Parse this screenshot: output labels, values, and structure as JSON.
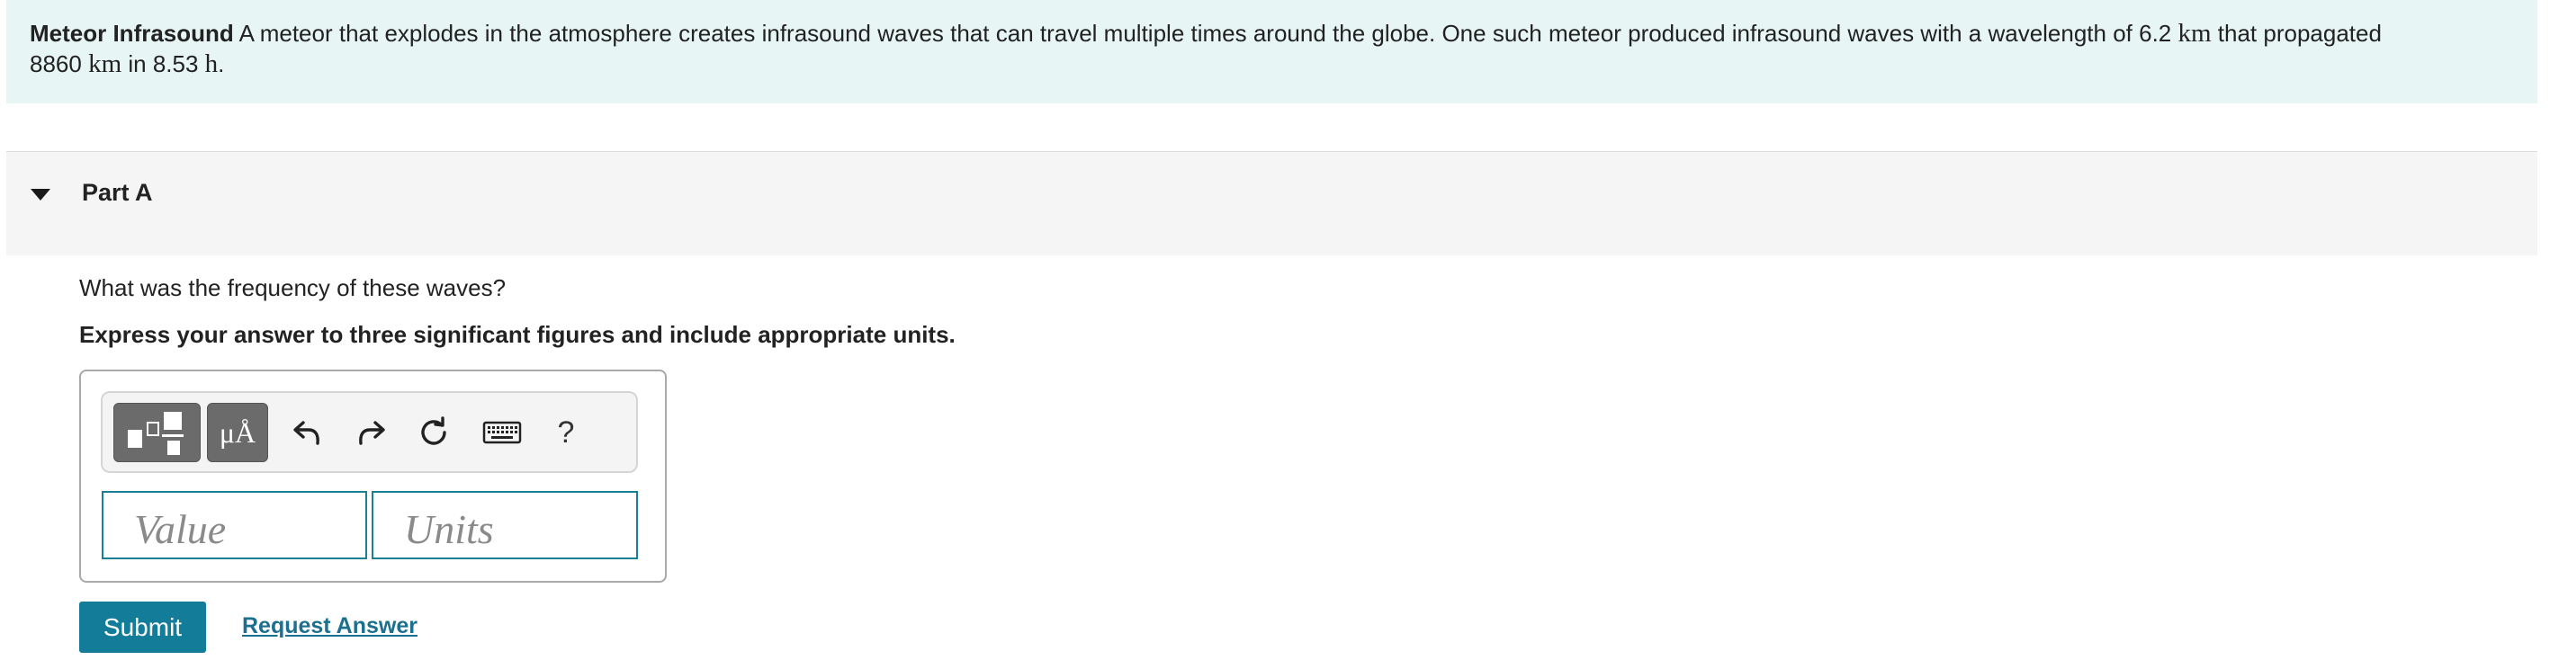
{
  "problem": {
    "title": "Meteor Infrasound",
    "text_1": " A meteor that explodes in the atmosphere creates infrasound waves that can travel multiple times around the globe. One such meteor produced infrasound waves with a wavelength of 6.2 ",
    "unit_km_1": "km",
    "text_2": " that propagated",
    "text_3": "8860 ",
    "unit_km_2": "km",
    "text_4": " in 8.53 ",
    "unit_h": "h",
    "text_5": "."
  },
  "part": {
    "title": "Part A",
    "question": "What was the frequency of these waves?",
    "instruction": "Express your answer to three significant figures and include appropriate units."
  },
  "toolbar": {
    "templates_icon": "templates-icon",
    "symbols_label": "μÅ",
    "undo_icon": "undo-icon",
    "redo_icon": "redo-icon",
    "reset_icon": "reset-icon",
    "keyboard_icon": "keyboard-icon",
    "help_label": "?"
  },
  "inputs": {
    "value_placeholder": "Value",
    "units_placeholder": "Units"
  },
  "actions": {
    "submit_label": "Submit",
    "request_answer_label": "Request Answer"
  },
  "colors": {
    "intro_background": "#e7f6f5",
    "accent": "#137d99",
    "link": "#1b6f8f"
  }
}
